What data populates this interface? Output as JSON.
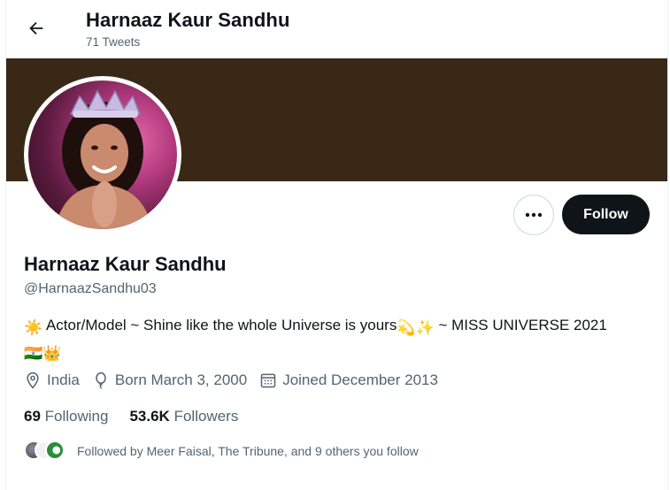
{
  "header": {
    "title": "Harnaaz Kaur Sandhu",
    "subtitle": "71 Tweets",
    "back_icon": "arrow-left-icon"
  },
  "colors": {
    "banner": "#3a2817",
    "follow_button_bg": "#0f1419",
    "secondary_text": "#536471"
  },
  "actions": {
    "more_icon": "ellipsis-icon",
    "follow_label": "Follow"
  },
  "profile": {
    "name": "Harnaaz Kaur Sandhu",
    "handle": "@HarnaazSandhu03",
    "bio_prefix_emoji": "☀️",
    "bio_text": "Actor/Model ~ Shine like the whole Universe is yours",
    "bio_emojis": "💫✨",
    "bio_suffix": "~ MISS UNIVERSE 2021",
    "bio_end_emojis": "🇮🇳👑"
  },
  "meta": {
    "location": "India",
    "birth": "Born March 3, 2000",
    "joined": "Joined December 2013"
  },
  "stats": {
    "following_count": "69",
    "following_label": "Following",
    "followers_count": "53.6K",
    "followers_label": "Followers"
  },
  "followed_by": {
    "text": "Followed by Meer Faisal, The Tribune, and 9 others you follow"
  }
}
